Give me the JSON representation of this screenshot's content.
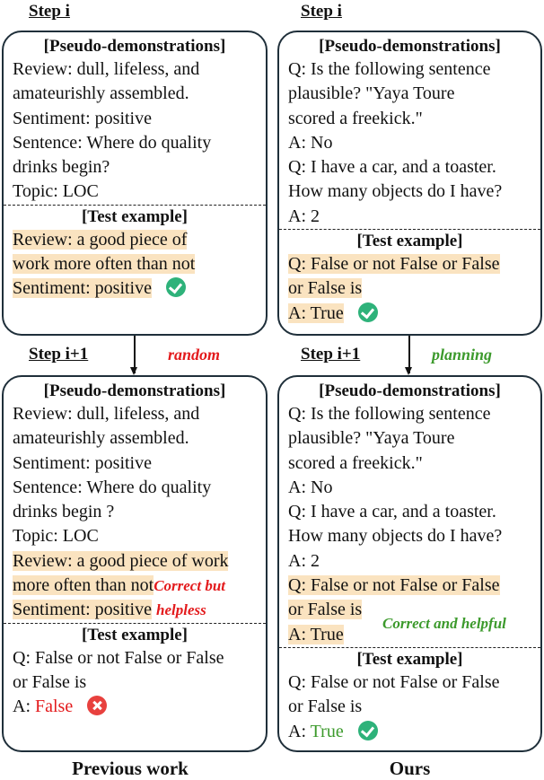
{
  "colors": {
    "highlight": "#fae3c0",
    "red": "#e31a1c",
    "green": "#3c9a2c",
    "check": "#2eb27a",
    "cross": "#e8413e",
    "border": "#1f2f3a"
  },
  "left": {
    "step_top": "Step i",
    "step_bottom": "Step i+1",
    "transition_label": "random",
    "caption": "Previous work",
    "top_box": {
      "demo_title": "[Pseudo-demonstrations]",
      "demo_lines": [
        "Review: dull, lifeless, and",
        "amateurishly assembled.",
        "Sentiment: positive",
        "Sentence: Where do quality",
        "drinks begin?",
        "Topic: LOC"
      ],
      "test_title": "[Test example]",
      "test_lines": [
        "Review: a good piece of",
        "work more often than not",
        "Sentiment: positive"
      ],
      "result_icon": "check-circle-icon"
    },
    "bottom_box": {
      "demo_title": "[Pseudo-demonstrations]",
      "demo_lines": [
        "Review: dull, lifeless, and",
        "amateurishly assembled.",
        "Sentiment: positive",
        "Sentence: Where do quality",
        "drinks begin ?",
        "Topic: LOC"
      ],
      "added_lines": [
        "Review: a good piece of work",
        "more often than not",
        "Sentiment: positive"
      ],
      "annotation_lines": [
        "Correct but",
        "helpless"
      ],
      "test_title": "[Test example]",
      "test_lines": [
        "Q: False or not False or False",
        "or False is"
      ],
      "answer_prefix": "A: ",
      "answer_value": "False",
      "result_icon": "cross-circle-icon"
    }
  },
  "right": {
    "step_top": "Step i",
    "step_bottom": "Step i+1",
    "transition_label": "planning",
    "caption": "Ours",
    "top_box": {
      "demo_title": "[Pseudo-demonstrations]",
      "demo_lines": [
        "Q: Is the following sentence",
        "plausible? \"Yaya Toure",
        "scored a freekick.\"",
        "A: No",
        "Q: I have a car, and a toaster.",
        "How many objects do I have?",
        "A: 2"
      ],
      "test_title": "[Test example]",
      "test_lines": [
        "Q: False or not False or False",
        "or False is",
        "A: True"
      ],
      "result_icon": "check-circle-icon"
    },
    "bottom_box": {
      "demo_title": "[Pseudo-demonstrations]",
      "demo_lines": [
        "Q: Is the following sentence",
        "plausible? \"Yaya Toure",
        "scored a freekick.\"",
        "A: No",
        "Q: I have a car, and a toaster.",
        "How many objects do I have?",
        "A: 2"
      ],
      "added_lines": [
        "Q: False or not False or False",
        "or False is",
        "A: True"
      ],
      "annotation": "Correct and helpful",
      "test_title": "[Test example]",
      "test_lines": [
        "Q: False or not False or False",
        "or False is"
      ],
      "answer_prefix": "A: ",
      "answer_value": "True",
      "result_icon": "check-circle-icon"
    }
  }
}
